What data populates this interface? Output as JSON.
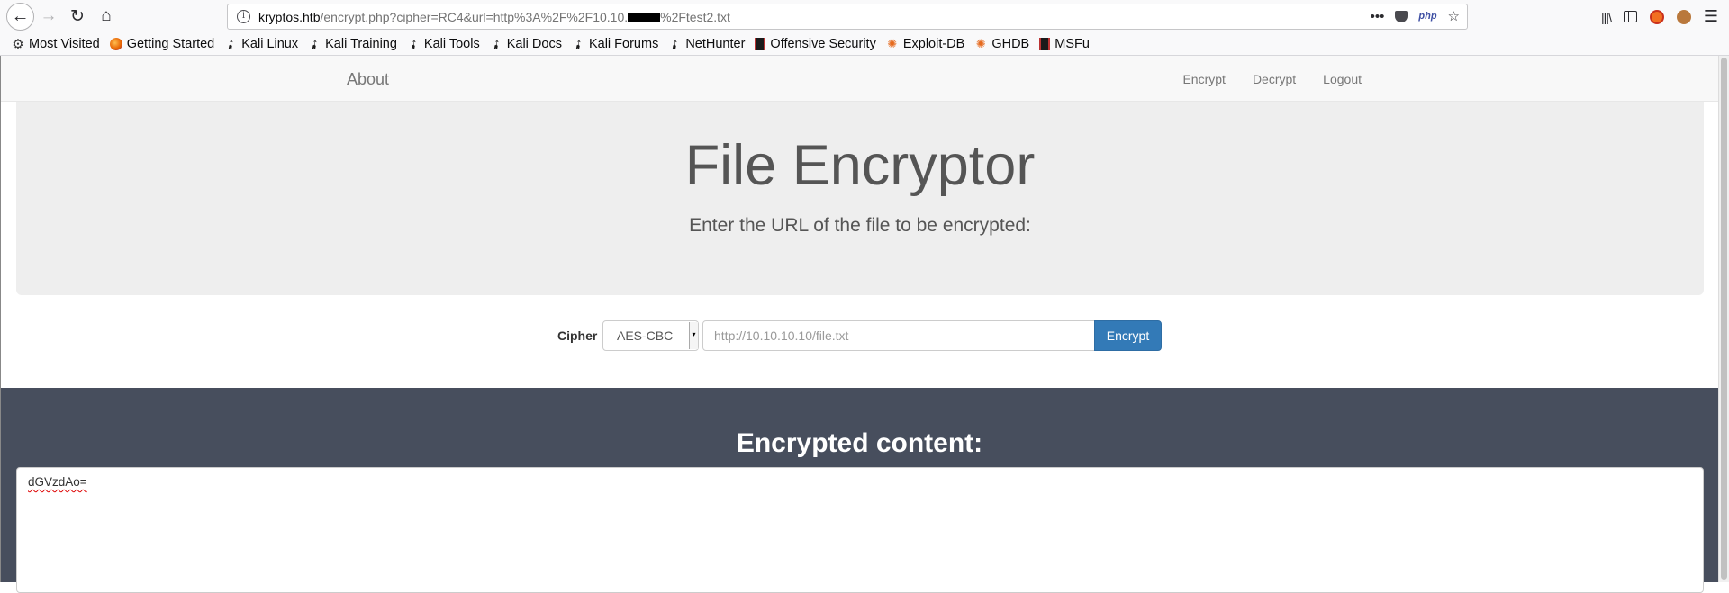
{
  "browser": {
    "url_host": "kryptos.htb",
    "url_path_before_redact": "/encrypt.php?cipher=RC4&url=http%3A%2F%2F10.10.",
    "url_path_after_redact": "%2Ftest2.txt",
    "url_actions": {
      "more": "•••",
      "php": "php",
      "star": "☆"
    },
    "bookmarks": [
      {
        "label": "Most Visited",
        "icon": "gear-icon"
      },
      {
        "label": "Getting Started",
        "icon": "firefox-icon"
      },
      {
        "label": "Kali Linux",
        "icon": "kali-dragon-icon"
      },
      {
        "label": "Kali Training",
        "icon": "kali-dragon-icon"
      },
      {
        "label": "Kali Tools",
        "icon": "kali-dragon-icon"
      },
      {
        "label": "Kali Docs",
        "icon": "kali-dragon-icon"
      },
      {
        "label": "Kali Forums",
        "icon": "kali-dragon-icon"
      },
      {
        "label": "NetHunter",
        "icon": "kali-dragon-icon"
      },
      {
        "label": "Offensive Security",
        "icon": "offsec-icon"
      },
      {
        "label": "Exploit-DB",
        "icon": "exploit-db-icon"
      },
      {
        "label": "GHDB",
        "icon": "exploit-db-icon"
      },
      {
        "label": "MSFu",
        "icon": "offsec-icon"
      }
    ]
  },
  "site": {
    "brand": "About",
    "nav": [
      "Encrypt",
      "Decrypt",
      "Logout"
    ],
    "title": "File Encryptor",
    "subtitle": "Enter the URL of the file to be encrypted:",
    "form": {
      "cipher_label": "Cipher",
      "cipher_selected": "AES-CBC",
      "url_placeholder": "http://10.10.10.10/file.txt",
      "submit_label": "Encrypt"
    },
    "result": {
      "heading": "Encrypted content:",
      "content": "dGVzdAo="
    }
  },
  "colors": {
    "primary_button": "#337ab7",
    "dark_section": "#474e5d",
    "jumbotron": "#eeeeee"
  }
}
